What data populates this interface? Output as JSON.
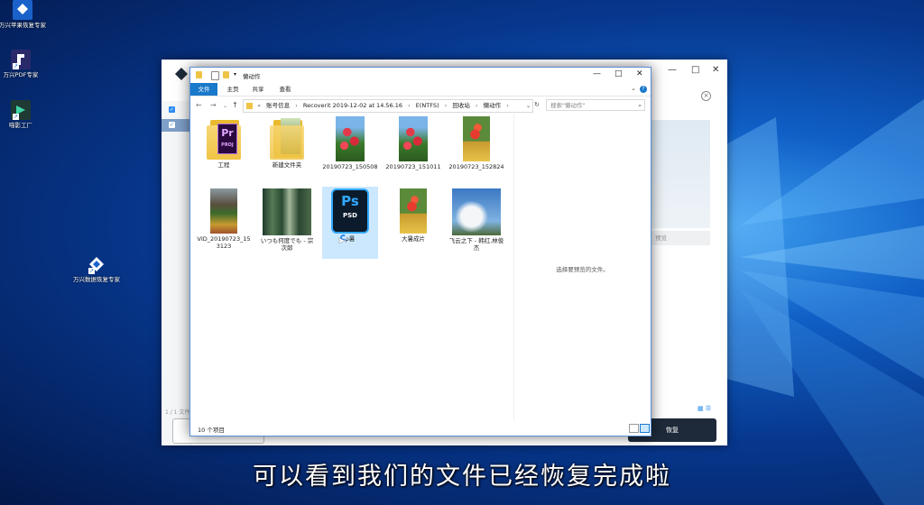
{
  "desktop": {
    "icons": [
      {
        "label": "万兴苹果恢复专家",
        "icon": "wondershare-recovery-icon",
        "color": "#1a62c9"
      },
      {
        "label": "万兴PDF专家",
        "icon": "pdf-expert-icon",
        "color": "#2a2a6a"
      },
      {
        "label": "喵影工厂",
        "icon": "filmora-icon",
        "color": "#1e3a33"
      },
      {
        "label": "万兴数据恢复专家",
        "icon": "data-recovery-icon",
        "color": "#ffffff"
      }
    ]
  },
  "back_window": {
    "count_text": "1 / 1 文件",
    "preview_btn": "预览",
    "recover_btn": "恢复"
  },
  "explorer": {
    "title": "懒动作",
    "ribbon_tabs": [
      "文件",
      "主页",
      "共享",
      "查看"
    ],
    "address": [
      "«",
      "账号信息",
      "Recoverit 2019-12-02 at 14.56.16",
      "E(NTFS)",
      "回收站",
      "懒动作"
    ],
    "search_placeholder": "搜索\"懒动作\"",
    "items": [
      {
        "name": "工程",
        "type": "pr-folder"
      },
      {
        "name": "新建文件夹",
        "type": "photo-folder"
      },
      {
        "name": "20190723_150508",
        "type": "photo-flower"
      },
      {
        "name": "20190723_151011",
        "type": "photo-flower"
      },
      {
        "name": "20190723_152824",
        "type": "photo-pot"
      },
      {
        "name": "VID_20190723_153123",
        "type": "photo-vid"
      },
      {
        "name": "いつも何度でも - 宗次郎",
        "type": "photo-forest"
      },
      {
        "name": "p暑",
        "type": "psd"
      },
      {
        "name": "大暑成片",
        "type": "photo-pot"
      },
      {
        "name": "飞云之下 - 韩红,林俊杰",
        "type": "photo-sky"
      }
    ],
    "preview_msg": "选择要预览的文件。",
    "status_count": "10 个项目"
  },
  "subtitle": "可以看到我们的文件已经恢复完成啦",
  "colors": {
    "accent": "#1979ca",
    "ps_blue": "#31a8ff",
    "selection": "#cce8ff"
  }
}
